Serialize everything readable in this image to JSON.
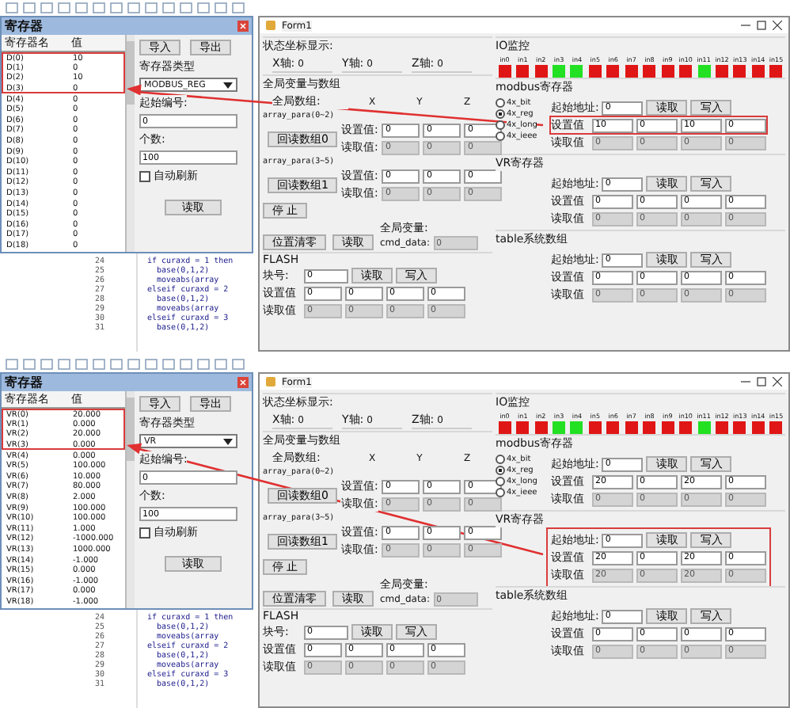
{
  "screenshots": [
    {
      "register_window": {
        "title": "寄存器",
        "columns": [
          "寄存器名",
          "值"
        ],
        "rows": [
          {
            "name": "D(0)",
            "value": "10",
            "highlighted": true
          },
          {
            "name": "D(1)",
            "value": "0",
            "highlighted": true
          },
          {
            "name": "D(2)",
            "value": "10",
            "highlighted": true
          },
          {
            "name": "D(3)",
            "value": "0",
            "highlighted": true
          },
          {
            "name": "D(4)",
            "value": "0",
            "highlighted": false
          },
          {
            "name": "D(5)",
            "value": "0",
            "highlighted": false
          },
          {
            "name": "D(6)",
            "value": "0",
            "highlighted": false
          },
          {
            "name": "D(7)",
            "value": "0",
            "highlighted": false
          },
          {
            "name": "D(8)",
            "value": "0",
            "highlighted": false
          },
          {
            "name": "D(9)",
            "value": "0",
            "highlighted": false
          },
          {
            "name": "D(10)",
            "value": "0",
            "highlighted": false
          },
          {
            "name": "D(11)",
            "value": "0",
            "highlighted": false
          },
          {
            "name": "D(12)",
            "value": "0",
            "highlighted": false
          },
          {
            "name": "D(13)",
            "value": "0",
            "highlighted": false
          },
          {
            "name": "D(14)",
            "value": "0",
            "highlighted": false
          },
          {
            "name": "D(15)",
            "value": "0",
            "highlighted": false
          },
          {
            "name": "D(16)",
            "value": "0",
            "highlighted": false
          },
          {
            "name": "D(17)",
            "value": "0",
            "highlighted": false
          },
          {
            "name": "D(18)",
            "value": "0",
            "highlighted": false
          }
        ],
        "import_button": "导入",
        "export_button": "导出",
        "type_label": "寄存器类型",
        "type_value": "MODBUS_REG",
        "start_label": "起始编号:",
        "start_value": "0",
        "count_label": "个数:",
        "count_value": "100",
        "auto_refresh_label": "自动刷新",
        "auto_refresh": false,
        "read_button": "读取"
      },
      "code": {
        "line_numbers": [
          "24",
          "25",
          "26",
          "27",
          "28",
          "29",
          "30",
          "31"
        ],
        "lines": [
          "if curaxd = 1 then",
          "  base(0,1,2)",
          "  moveabs(array",
          "elseif curaxd = 2",
          "  base(0,1,2)",
          "  moveabs(array",
          "elseif curaxd = 3",
          "  base(0,1,2)"
        ]
      },
      "form": {
        "title": "Form1",
        "status": {
          "title": "状态坐标显示:",
          "axes": [
            {
              "label": "X轴:",
              "value": "0"
            },
            {
              "label": "Y轴:",
              "value": "0"
            },
            {
              "label": "Z轴:",
              "value": "0"
            }
          ]
        },
        "globals": {
          "title": "全局变量与数组",
          "array_label": "全局数组:",
          "columns": [
            "X",
            "Y",
            "Z"
          ],
          "arrays": [
            {
              "name": "array_para(0~2)",
              "button": "回读数组0",
              "rows": [
                {
                  "label": "设置值:",
                  "values": [
                    "0",
                    "0",
                    "0"
                  ],
                  "readonly": false
                },
                {
                  "label": "读取值:",
                  "values": [
                    "0",
                    "0",
                    "0"
                  ],
                  "readonly": true
                }
              ]
            },
            {
              "name": "array_para(3~5)",
              "button": "回读数组1",
              "rows": [
                {
                  "label": "设置值:",
                  "values": [
                    "0",
                    "0",
                    "0"
                  ],
                  "readonly": false
                },
                {
                  "label": "读取值:",
                  "values": [
                    "0",
                    "0",
                    "0"
                  ],
                  "readonly": true
                }
              ]
            }
          ],
          "stop_button": "停 止",
          "zero_button": "位置清零",
          "read_button": "读取",
          "var_label": "全局变量:",
          "var_name": "cmd_data:",
          "var_value": "0"
        },
        "flash": {
          "title": "FLASH",
          "block_label": "块号:",
          "block_value": "0",
          "read_button": "读取",
          "write_button": "写入",
          "rows": [
            {
              "label": "设置值",
              "values": [
                "0",
                "0",
                "0",
                "0"
              ],
              "readonly": false
            },
            {
              "label": "读取值",
              "values": [
                "0",
                "0",
                "0",
                "0"
              ],
              "readonly": true
            }
          ]
        },
        "io": {
          "title": "IO监控",
          "inputs": [
            {
              "label": "in0",
              "on": false
            },
            {
              "label": "in1",
              "on": false
            },
            {
              "label": "in2",
              "on": false
            },
            {
              "label": "in3",
              "on": true
            },
            {
              "label": "in4",
              "on": true
            },
            {
              "label": "in5",
              "on": false
            },
            {
              "label": "in6",
              "on": false
            },
            {
              "label": "in7",
              "on": false
            },
            {
              "label": "in8",
              "on": false
            },
            {
              "label": "in9",
              "on": false
            },
            {
              "label": "in10",
              "on": false
            },
            {
              "label": "in11",
              "on": true
            },
            {
              "label": "in12",
              "on": false
            },
            {
              "label": "in13",
              "on": false
            },
            {
              "label": "in14",
              "on": false
            },
            {
              "label": "in15",
              "on": false
            }
          ]
        },
        "groups": [
          {
            "title": "modbus寄存器",
            "radios": [
              {
                "label": "4x_bit",
                "selected": false
              },
              {
                "label": "4x_reg",
                "selected": true
              },
              {
                "label": "4x_long",
                "selected": false
              },
              {
                "label": "4x_ieee",
                "selected": false
              }
            ],
            "address_label": "起始地址:",
            "address": "0",
            "read_button": "读取",
            "write_button": "写入",
            "highlighted": false,
            "rows": [
              {
                "label": "设置值",
                "values": [
                  "10",
                  "0",
                  "10",
                  "0"
                ],
                "readonly": false,
                "highlighted": true
              },
              {
                "label": "读取值",
                "values": [
                  "0",
                  "0",
                  "0",
                  "0"
                ],
                "readonly": true,
                "highlighted": false
              }
            ]
          },
          {
            "title": "VR寄存器",
            "address_label": "起始地址:",
            "address": "0",
            "read_button": "读取",
            "write_button": "写入",
            "highlighted": false,
            "rows": [
              {
                "label": "设置值",
                "values": [
                  "0",
                  "0",
                  "0",
                  "0"
                ],
                "readonly": false,
                "highlighted": false
              },
              {
                "label": "读取值",
                "values": [
                  "0",
                  "0",
                  "0",
                  "0"
                ],
                "readonly": true,
                "highlighted": false
              }
            ]
          },
          {
            "title": "table系统数组",
            "address_label": "起始地址:",
            "address": "0",
            "read_button": "读取",
            "write_button": "写入",
            "highlighted": false,
            "rows": [
              {
                "label": "设置值",
                "values": [
                  "0",
                  "0",
                  "0",
                  "0"
                ],
                "readonly": false,
                "highlighted": false
              },
              {
                "label": "读取值",
                "values": [
                  "0",
                  "0",
                  "0",
                  "0"
                ],
                "readonly": true,
                "highlighted": false
              }
            ]
          }
        ]
      },
      "arrow": true
    },
    {
      "register_window": {
        "title": "寄存器",
        "columns": [
          "寄存器名",
          "值"
        ],
        "rows": [
          {
            "name": "VR(0)",
            "value": "20.000",
            "highlighted": true
          },
          {
            "name": "VR(1)",
            "value": "0.000",
            "highlighted": true
          },
          {
            "name": "VR(2)",
            "value": "20.000",
            "highlighted": true
          },
          {
            "name": "VR(3)",
            "value": "0.000",
            "highlighted": true
          },
          {
            "name": "VR(4)",
            "value": "0.000",
            "highlighted": false
          },
          {
            "name": "VR(5)",
            "value": "100.000",
            "highlighted": false
          },
          {
            "name": "VR(6)",
            "value": "10.000",
            "highlighted": false
          },
          {
            "name": "VR(7)",
            "value": "80.000",
            "highlighted": false
          },
          {
            "name": "VR(8)",
            "value": "2.000",
            "highlighted": false
          },
          {
            "name": "VR(9)",
            "value": "100.000",
            "highlighted": false
          },
          {
            "name": "VR(10)",
            "value": "100.000",
            "highlighted": false
          },
          {
            "name": "VR(11)",
            "value": "1.000",
            "highlighted": false
          },
          {
            "name": "VR(12)",
            "value": "-1000.000",
            "highlighted": false
          },
          {
            "name": "VR(13)",
            "value": "1000.000",
            "highlighted": false
          },
          {
            "name": "VR(14)",
            "value": "-1.000",
            "highlighted": false
          },
          {
            "name": "VR(15)",
            "value": "0.000",
            "highlighted": false
          },
          {
            "name": "VR(16)",
            "value": "-1.000",
            "highlighted": false
          },
          {
            "name": "VR(17)",
            "value": "0.000",
            "highlighted": false
          },
          {
            "name": "VR(18)",
            "value": "-1.000",
            "highlighted": false
          }
        ],
        "import_button": "导入",
        "export_button": "导出",
        "type_label": "寄存器类型",
        "type_value": "VR",
        "start_label": "起始编号:",
        "start_value": "0",
        "count_label": "个数:",
        "count_value": "100",
        "auto_refresh_label": "自动刷新",
        "auto_refresh": false,
        "read_button": "读取"
      },
      "code": {
        "line_numbers": [
          "24",
          "25",
          "26",
          "27",
          "28",
          "29",
          "30",
          "31"
        ],
        "lines": [
          "if curaxd = 1 then",
          "  base(0,1,2)",
          "  moveabs(array",
          "elseif curaxd = 2",
          "  base(0,1,2)",
          "  moveabs(array",
          "elseif curaxd = 3",
          "  base(0,1,2)"
        ]
      },
      "form": {
        "title": "Form1",
        "status": {
          "title": "状态坐标显示:",
          "axes": [
            {
              "label": "X轴:",
              "value": "0"
            },
            {
              "label": "Y轴:",
              "value": "0"
            },
            {
              "label": "Z轴:",
              "value": "0"
            }
          ]
        },
        "globals": {
          "title": "全局变量与数组",
          "array_label": "全局数组:",
          "columns": [
            "X",
            "Y",
            "Z"
          ],
          "arrays": [
            {
              "name": "array_para(0~2)",
              "button": "回读数组0",
              "rows": [
                {
                  "label": "设置值:",
                  "values": [
                    "0",
                    "0",
                    "0"
                  ],
                  "readonly": false
                },
                {
                  "label": "读取值:",
                  "values": [
                    "0",
                    "0",
                    "0"
                  ],
                  "readonly": true
                }
              ]
            },
            {
              "name": "array_para(3~5)",
              "button": "回读数组1",
              "rows": [
                {
                  "label": "设置值:",
                  "values": [
                    "0",
                    "0",
                    "0"
                  ],
                  "readonly": false
                },
                {
                  "label": "读取值:",
                  "values": [
                    "0",
                    "0",
                    "0"
                  ],
                  "readonly": true
                }
              ]
            }
          ],
          "stop_button": "停 止",
          "zero_button": "位置清零",
          "read_button": "读取",
          "var_label": "全局变量:",
          "var_name": "cmd_data:",
          "var_value": "0"
        },
        "flash": {
          "title": "FLASH",
          "block_label": "块号:",
          "block_value": "0",
          "read_button": "读取",
          "write_button": "写入",
          "rows": [
            {
              "label": "设置值",
              "values": [
                "0",
                "0",
                "0",
                "0"
              ],
              "readonly": false
            },
            {
              "label": "读取值",
              "values": [
                "0",
                "0",
                "0",
                "0"
              ],
              "readonly": true
            }
          ]
        },
        "io": {
          "title": "IO监控",
          "inputs": [
            {
              "label": "in0",
              "on": false
            },
            {
              "label": "in1",
              "on": false
            },
            {
              "label": "in2",
              "on": false
            },
            {
              "label": "in3",
              "on": true
            },
            {
              "label": "in4",
              "on": true
            },
            {
              "label": "in5",
              "on": false
            },
            {
              "label": "in6",
              "on": false
            },
            {
              "label": "in7",
              "on": false
            },
            {
              "label": "in8",
              "on": false
            },
            {
              "label": "in9",
              "on": false
            },
            {
              "label": "in10",
              "on": false
            },
            {
              "label": "in11",
              "on": true
            },
            {
              "label": "in12",
              "on": false
            },
            {
              "label": "in13",
              "on": false
            },
            {
              "label": "in14",
              "on": false
            },
            {
              "label": "in15",
              "on": false
            }
          ]
        },
        "groups": [
          {
            "title": "modbus寄存器",
            "radios": [
              {
                "label": "4x_bit",
                "selected": false
              },
              {
                "label": "4x_reg",
                "selected": true
              },
              {
                "label": "4x_long",
                "selected": false
              },
              {
                "label": "4x_ieee",
                "selected": false
              }
            ],
            "address_label": "起始地址:",
            "address": "0",
            "read_button": "读取",
            "write_button": "写入",
            "highlighted": false,
            "rows": [
              {
                "label": "设置值",
                "values": [
                  "20",
                  "0",
                  "20",
                  "0"
                ],
                "readonly": false,
                "highlighted": false
              },
              {
                "label": "读取值",
                "values": [
                  "0",
                  "0",
                  "0",
                  "0"
                ],
                "readonly": true,
                "highlighted": false
              }
            ]
          },
          {
            "title": "VR寄存器",
            "address_label": "起始地址:",
            "address": "0",
            "read_button": "读取",
            "write_button": "写入",
            "highlighted": true,
            "rows": [
              {
                "label": "设置值",
                "values": [
                  "20",
                  "0",
                  "20",
                  "0"
                ],
                "readonly": false,
                "highlighted": false
              },
              {
                "label": "读取值",
                "values": [
                  "20",
                  "0",
                  "20",
                  "0"
                ],
                "readonly": true,
                "highlighted": false
              }
            ]
          },
          {
            "title": "table系统数组",
            "address_label": "起始地址:",
            "address": "0",
            "read_button": "读取",
            "write_button": "写入",
            "highlighted": false,
            "rows": [
              {
                "label": "设置值",
                "values": [
                  "0",
                  "0",
                  "0",
                  "0"
                ],
                "readonly": false,
                "highlighted": false
              },
              {
                "label": "读取值",
                "values": [
                  "0",
                  "0",
                  "0",
                  "0"
                ],
                "readonly": true,
                "highlighted": false
              }
            ]
          }
        ]
      },
      "arrow": true
    }
  ]
}
